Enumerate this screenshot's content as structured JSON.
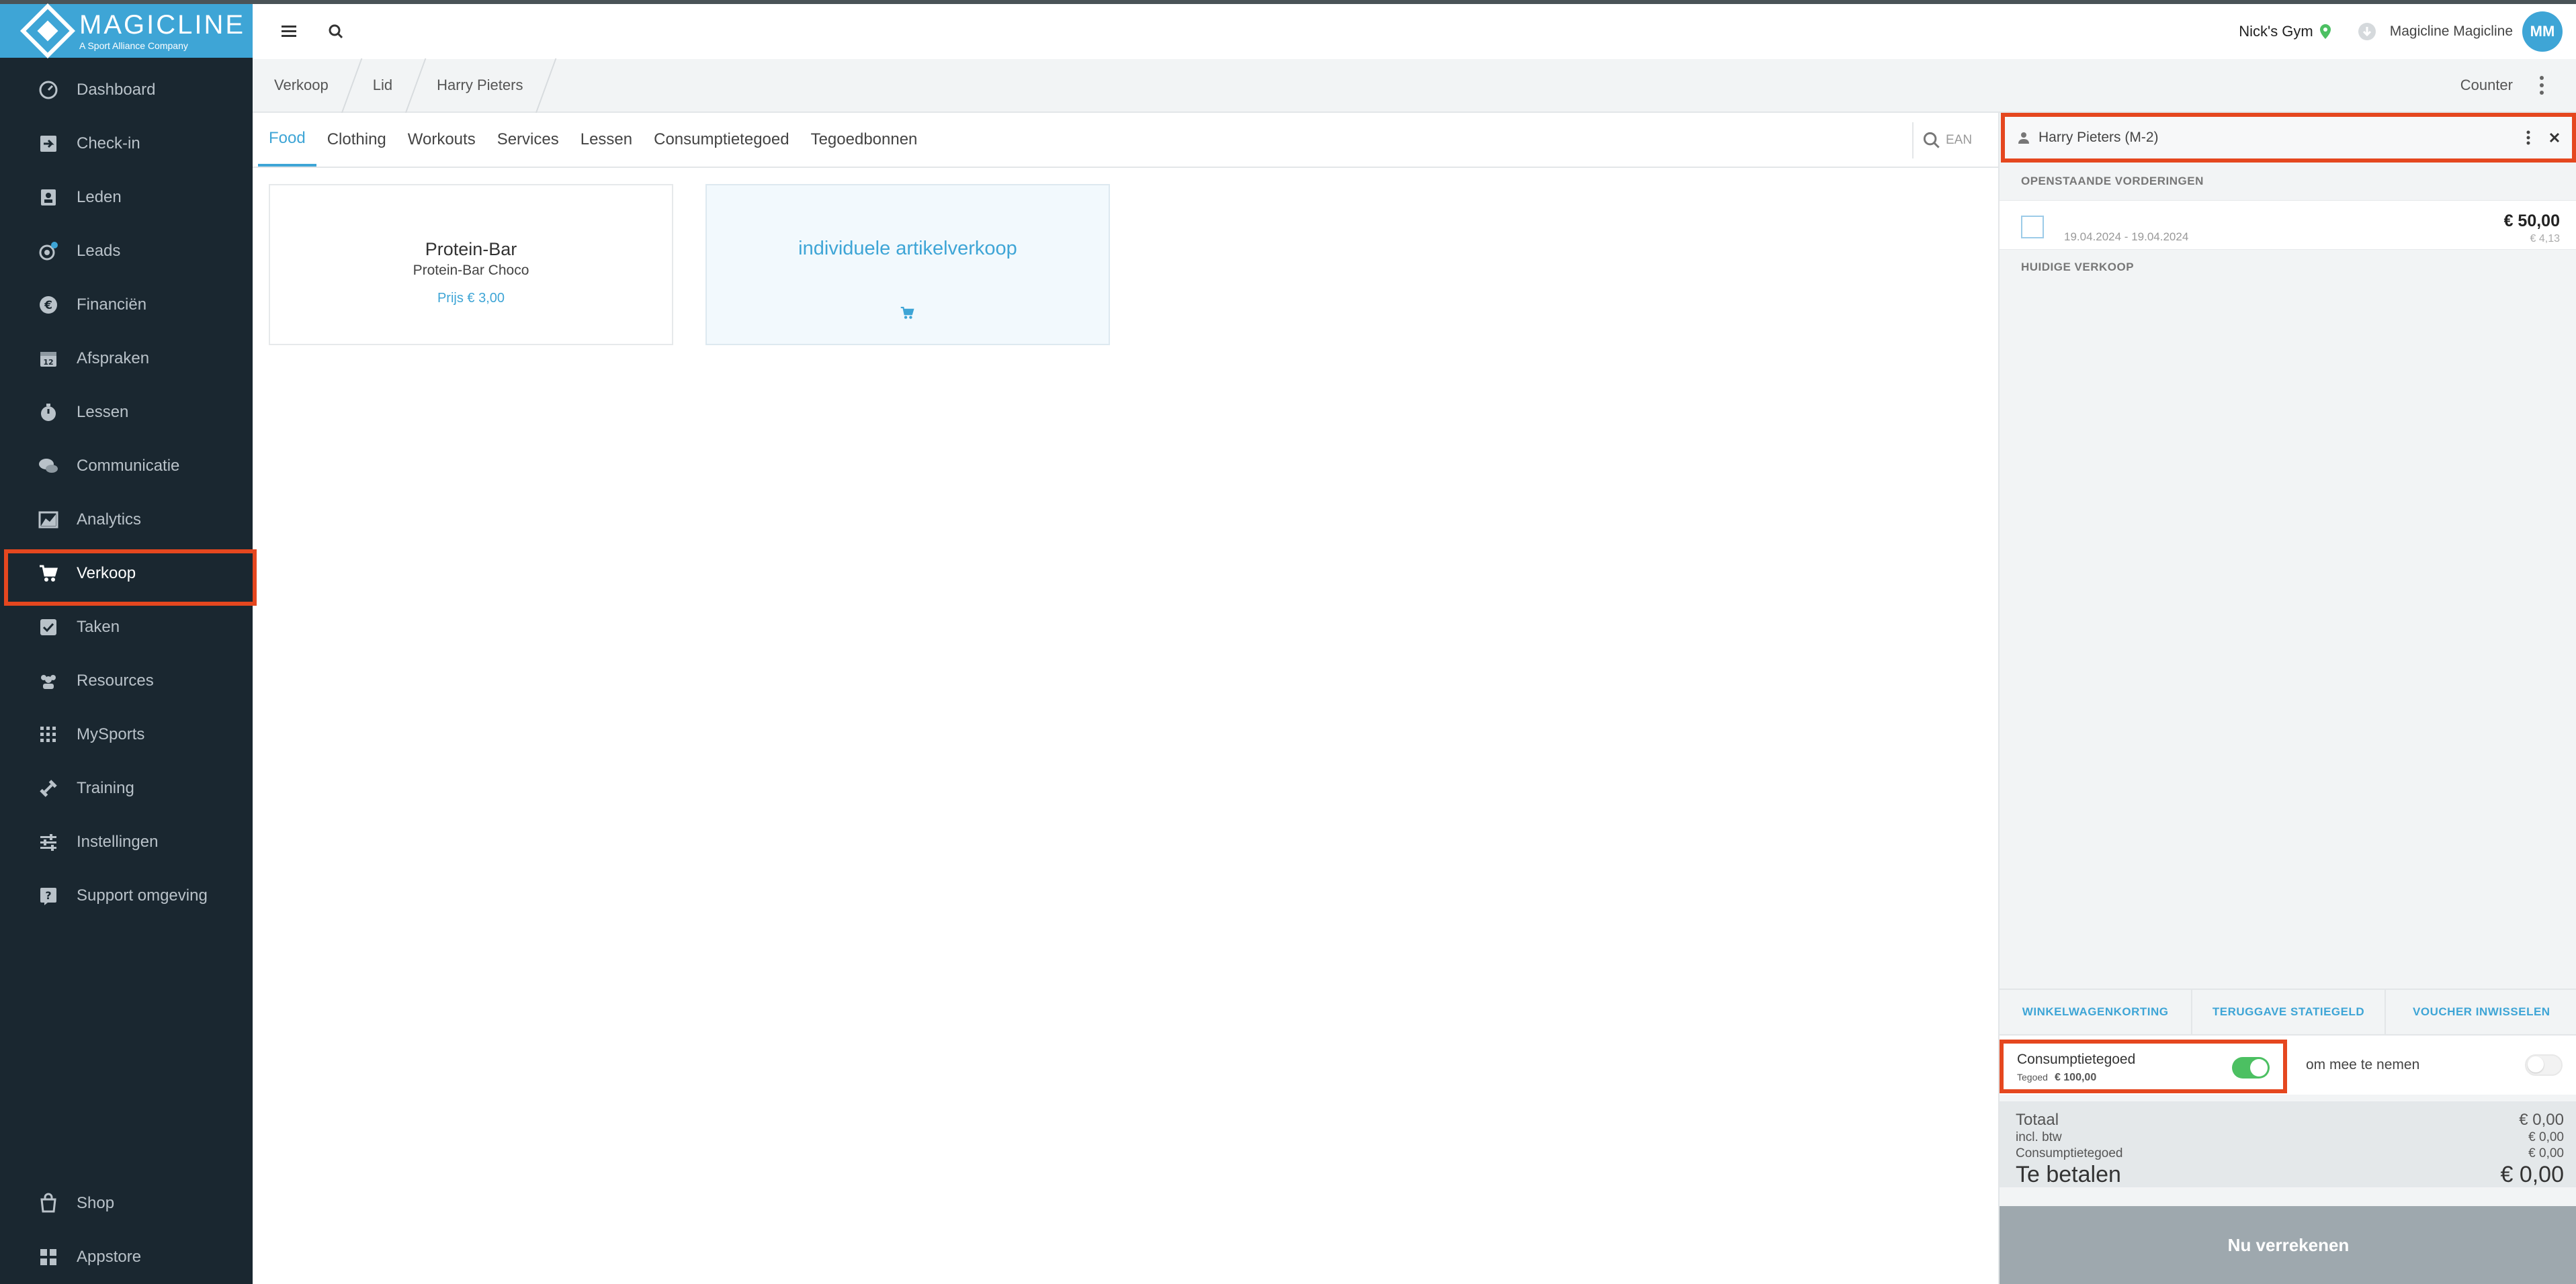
{
  "brand": {
    "name": "MAGICLINE",
    "tagline": "A Sport Alliance Company",
    "color": "#3ea5d6"
  },
  "sidebar": {
    "items": [
      {
        "label": "Dashboard",
        "icon": "dashboard-icon"
      },
      {
        "label": "Check-in",
        "icon": "check-in-icon"
      },
      {
        "label": "Leden",
        "icon": "members-icon"
      },
      {
        "label": "Leads",
        "icon": "leads-icon"
      },
      {
        "label": "Financiën",
        "icon": "euro-icon"
      },
      {
        "label": "Afspraken",
        "icon": "calendar-icon"
      },
      {
        "label": "Lessen",
        "icon": "stopwatch-icon"
      },
      {
        "label": "Communicatie",
        "icon": "chat-icon"
      },
      {
        "label": "Analytics",
        "icon": "chart-icon"
      },
      {
        "label": "Verkoop",
        "icon": "cart-icon",
        "active": true
      },
      {
        "label": "Taken",
        "icon": "checkbox-icon"
      },
      {
        "label": "Resources",
        "icon": "users-icon"
      },
      {
        "label": "MySports",
        "icon": "grid-dots-icon"
      },
      {
        "label": "Training",
        "icon": "dumbbell-icon"
      },
      {
        "label": "Instellingen",
        "icon": "sliders-icon"
      },
      {
        "label": "Support omgeving",
        "icon": "help-icon"
      }
    ],
    "bottom": [
      {
        "label": "Shop",
        "icon": "shop-icon"
      },
      {
        "label": "Appstore",
        "icon": "apps-icon"
      }
    ]
  },
  "topbar": {
    "gym": "Nick's Gym",
    "user": "Magicline Magicline",
    "avatar": "MM"
  },
  "breadcrumb": [
    "Verkoop",
    "Lid",
    "Harry Pieters"
  ],
  "counter_label": "Counter",
  "tabs": [
    "Food",
    "Clothing",
    "Workouts",
    "Services",
    "Lessen",
    "Consumptietegoed",
    "Tegoedbonnen"
  ],
  "active_tab": "Food",
  "ean_placeholder": "EAN",
  "products": [
    {
      "title": "Protein-Bar",
      "subtitle": "Protein-Bar Choco",
      "price": "Prijs € 3,00"
    }
  ],
  "individual_sale": "individuele artikelverkoop",
  "panel": {
    "member": "Harry Pieters (M-2)",
    "open_claims_header": "OPENSTAANDE VORDERINGEN",
    "claim": {
      "date": "19.04.2024 - 19.04.2024",
      "amount": "€ 50,00",
      "sub": "€ 4,13"
    },
    "current_sale_header": "HUIDIGE VERKOOP",
    "actions": [
      "WINKELWAGENKORTING",
      "TERUGGAVE STATIEGELD",
      "VOUCHER INWISSELEN"
    ],
    "credit": {
      "label": "Consumptietegoed",
      "sub_label": "Tegoed",
      "sub_value": "€ 100,00",
      "enabled": true
    },
    "takeaway": {
      "label": "om mee te nemen",
      "enabled": false
    },
    "totals": {
      "total_label": "Totaal",
      "total_value": "€ 0,00",
      "vat_label": "incl. btw",
      "vat_value": "€ 0,00",
      "credit_label": "Consumptietegoed",
      "credit_value": "€ 0,00",
      "pay_label": "Te betalen",
      "pay_value": "€ 0,00"
    },
    "submit": "Nu verrekenen"
  },
  "colors": {
    "sidebar": "#1a2730",
    "highlight": "#e5471f",
    "toggle_on": "#4cc062"
  }
}
